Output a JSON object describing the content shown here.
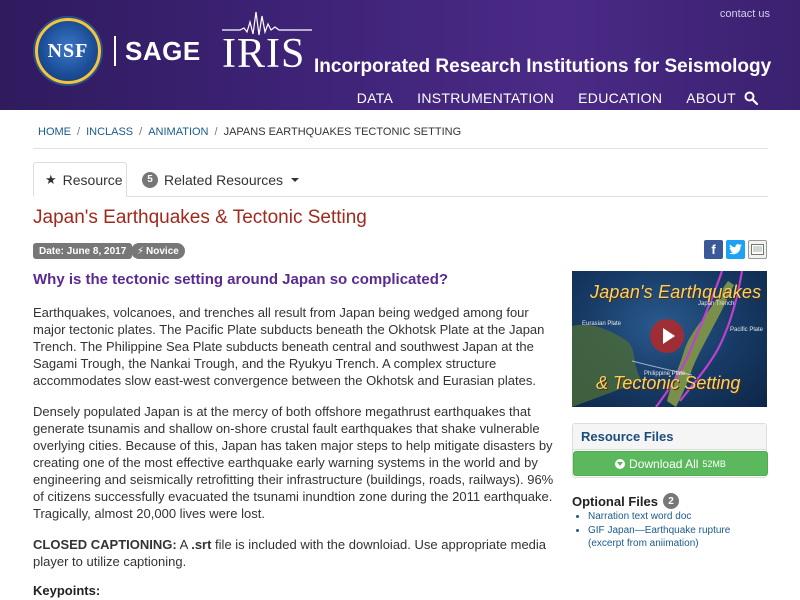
{
  "header": {
    "contact_label": "contact us",
    "nsf_logo_text": "NSF",
    "sage_label": "SAGE",
    "iris_logo_text": "IRIS",
    "iris_full_name": "Incorporated Research Institutions for Seismology",
    "nav": [
      "DATA",
      "INSTRUMENTATION",
      "EDUCATION",
      "ABOUT"
    ],
    "search_icon": "search-icon",
    "background_color": "#3f2378"
  },
  "breadcrumb": {
    "items": [
      "HOME",
      "INCLASS",
      "ANIMATION"
    ],
    "current": "JAPANS EARTHQUAKES TECTONIC SETTING"
  },
  "tabs": {
    "resource_label": "Resource",
    "related_count": "5",
    "related_label": "Related Resources"
  },
  "resource": {
    "title": "Japan's Earthquakes & Tectonic Setting",
    "date": "Date: June 8, 2017",
    "level": "Novice",
    "title_color": "#a0291e",
    "question": "Why is the tectonic setting around Japan so complicated?",
    "paragraphs": [
      "Earthquakes, volcanoes, and trenches all result from Japan being wedged among four major tectonic plates. The Pacific Plate subducts beneath the Okhotsk Plate at the Japan Trench. The Philippine Sea Plate subducts beneath central and southwest Japan at the Sagami Trough, the Nankai Trough, and the Ryukyu Trench. A complex structure accommodates slow east-west convergence between the Okhotsk and Eurasian plates.",
      "Densely populated Japan is at the mercy of both offshore megathrust earthquakes that generate tsunamis and shallow on-shore crustal fault earthquakes that shake vulnerable overlying cities. Because of this, Japan has taken major steps to help mitigate disasters by creating one of the most effective earthquake early warning systems in the world and by engineering and seismically retrofitting their infrastructure (buildings, roads, railways). 96% of citizens successfully evacuated the tsunami inundtion zone during the 2011 earthquake. Tragically, almost 20,000 lives were lost."
    ],
    "captioning_label": "CLOSED CAPTIONING:",
    "captioning_text_a": " A ",
    "captioning_ext": ".srt",
    "captioning_text_b": " file is included with the downloiad. Use appropriate media player to utilize captioning.",
    "keypoints_label": "Keypoints:"
  },
  "video": {
    "title_line1": "Japan's Earthquakes",
    "title_line2": "& Tectonic Setting",
    "labels": {
      "eurasian": "Eurasian Plate",
      "japan_trench": "Japan Trench",
      "pacific": "Pacific Plate",
      "philippine": "Philippine Plate"
    }
  },
  "sidebar": {
    "resource_files_label": "Resource Files",
    "download_label": "Download All",
    "download_size": "52MB",
    "download_color": "#5cb85c",
    "optional_files_label": "Optional Files",
    "optional_files_count": "2",
    "optional_files": [
      "Narration text word doc",
      "GIF Japan—Earthquake rupture (excerpt from aniimation)"
    ]
  },
  "share": {
    "facebook_icon": "facebook-icon",
    "twitter_icon": "twitter-icon",
    "classroom_icon": "google-classroom-icon"
  }
}
